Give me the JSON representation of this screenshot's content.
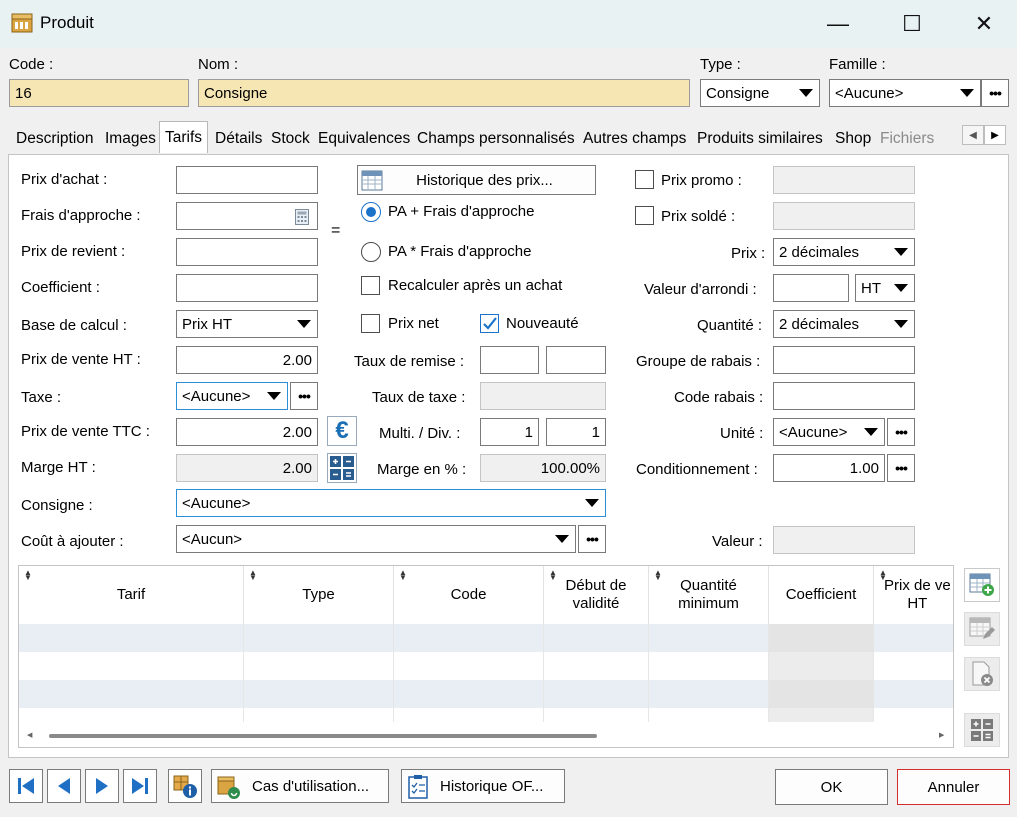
{
  "window": {
    "title": "Produit",
    "minimize": "—",
    "maximize": "☐",
    "close": "✕"
  },
  "header": {
    "code_label": "Code :",
    "code_value": "16",
    "nom_label": "Nom :",
    "nom_value": "Consigne",
    "type_label": "Type :",
    "type_value": "Consigne",
    "famille_label": "Famille :",
    "famille_value": "<Aucune>"
  },
  "tabs": [
    "Description",
    "Images",
    "Tarifs",
    "Détails",
    "Stock",
    "Equivalences",
    "Champs personnalisés",
    "Autres champs",
    "Produits similaires",
    "Shop",
    "Fichiers"
  ],
  "active_tab": "Tarifs",
  "left": {
    "prix_achat_label": "Prix d'achat :",
    "prix_achat_value": "",
    "frais_label": "Frais d'approche :",
    "frais_value": "",
    "equals": "=",
    "prix_revient_label": "Prix de revient :",
    "prix_revient_value": "",
    "coef_label": "Coefficient :",
    "coef_value": "",
    "base_label": "Base de calcul :",
    "base_value": "Prix HT",
    "pv_ht_label": "Prix de vente HT :",
    "pv_ht_value": "2.00",
    "taxe_label": "Taxe :",
    "taxe_value": "<Aucune>",
    "pv_ttc_label": "Prix de vente TTC :",
    "pv_ttc_value": "2.00",
    "marge_label": "Marge HT :",
    "marge_value": "2.00",
    "consigne_label": "Consigne :",
    "consigne_value": "<Aucune>",
    "cout_label": "Coût à ajouter :",
    "cout_value": "<Aucun>"
  },
  "middle": {
    "historique_btn": "Historique des prix...",
    "radio1": "PA + Frais d'approche",
    "radio2": "PA * Frais d'approche",
    "recalc": "Recalculer après un achat",
    "prix_net": "Prix net",
    "nouveaute": "Nouveauté",
    "remise_label": "Taux de remise :",
    "remise_1": "",
    "remise_2": "",
    "taux_taxe_label": "Taux de taxe :",
    "taux_taxe_value": "",
    "multi_label": "Multi. / Div. :",
    "multi_value": "1",
    "div_value": "1",
    "marge_pct_label": "Marge en % :",
    "marge_pct_value": "100.00%"
  },
  "right": {
    "promo_label": "Prix promo :",
    "promo_value": "",
    "solde_label": "Prix soldé :",
    "solde_value": "",
    "prix_label": "Prix :",
    "prix_value": "2 décimales",
    "arrondi_label": "Valeur d'arrondi :",
    "arrondi_value": "",
    "arrondi_mode": "HT",
    "quantite_label": "Quantité :",
    "quantite_value": "2 décimales",
    "groupe_label": "Groupe de rabais :",
    "groupe_value": "",
    "code_rabais_label": "Code rabais :",
    "code_rabais_value": "",
    "unite_label": "Unité :",
    "unite_value": "<Aucune>",
    "cond_label": "Conditionnement :",
    "cond_value": "1.00",
    "valeur_label": "Valeur :",
    "valeur_value": ""
  },
  "grid": {
    "col_tarif": "Tarif",
    "col_type": "Type",
    "col_code": "Code",
    "col_debut_1": "Début de",
    "col_debut_2": "validité",
    "col_qte_1": "Quantité",
    "col_qte_2": "minimum",
    "col_coef": "Coefficient",
    "col_pv_1": "Prix de ve",
    "col_pv_2": "HT"
  },
  "footer": {
    "cas_btn": "Cas d'utilisation...",
    "hist_of_btn": "Historique OF...",
    "ok_btn": "OK",
    "cancel_btn": "Annuler"
  },
  "colors": {
    "accent": "#1a73c9",
    "field_yellow": "#f5e6b4",
    "cancel_border": "#d32f2f"
  }
}
